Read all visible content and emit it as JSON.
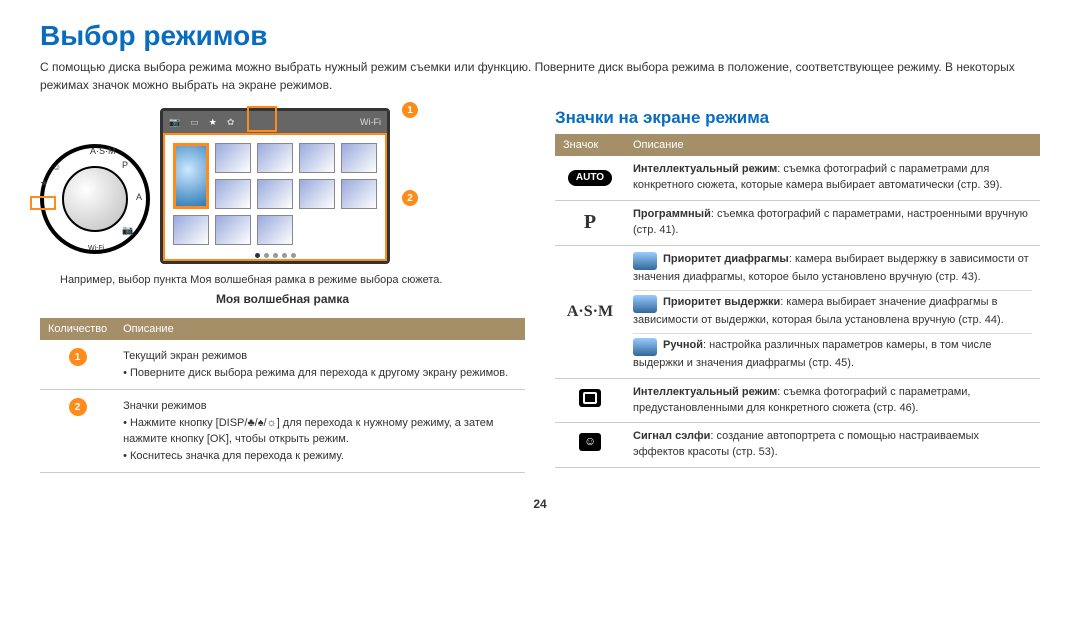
{
  "page": {
    "title": "Выбор режимов",
    "intro": "С помощью диска выбора режима можно выбрать нужный режим съемки или функцию. Поверните диск выбора режима в положение, соответствующее режиму. В некоторых режимах значок можно выбрать на экране режимов.",
    "number": "24"
  },
  "figure": {
    "caption_example": "Например, выбор пункта Моя волшебная рамка в режиме выбора сюжета.",
    "mode_name": "Моя волшебная рамка",
    "top_wifi": "Wi-Fi",
    "callout1": "1",
    "callout2": "2",
    "dial_wifi": "Wi-Fi"
  },
  "table1": {
    "head_qty": "Количество",
    "head_desc": "Описание",
    "rows": [
      {
        "idx": "1",
        "text": "Текущий экран режимов\n• Поверните диск выбора режима для перехода к другому экрану режимов."
      },
      {
        "idx": "2",
        "text": "Значки режимов\n• Нажмите кнопку [DISP/♣/♠/☼] для перехода к нужному режиму, а затем нажмите кнопку [OK], чтобы открыть режим.\n• Коснитесь значка для перехода к режиму."
      }
    ]
  },
  "right": {
    "subtitle": "Значки на экране режима",
    "head_icon": "Значок",
    "head_desc": "Описание"
  },
  "icons_table": [
    {
      "icon_kind": "auto",
      "icon_text": "AUTO",
      "desc_bold": "Интеллектуальный режим",
      "desc_rest": ": съемка фотографий с параметрами для конкретного сюжета, которые камера выбирает автоматически (стр. 39)."
    },
    {
      "icon_kind": "p",
      "icon_text": "P",
      "desc_bold": "Программный",
      "desc_rest": ": съемка фотографий с параметрами, настроенными вручную (стр. 41)."
    },
    {
      "icon_kind": "asm",
      "icon_text": "A·S·M",
      "sub": [
        {
          "bold": "Приоритет диафрагмы",
          "rest": ": камера выбирает выдержку в зависимости от значения диафрагмы, которое было установлено вручную (стр. 43)."
        },
        {
          "bold": "Приоритет выдержки",
          "rest": ": камера выбирает значение диафрагмы в зависимости от выдержки, которая была установлена вручную (стр. 44)."
        },
        {
          "bold": "Ручной",
          "rest": ": настройка различных параметров камеры, в том числе выдержки и значения диафрагмы (стр. 45)."
        }
      ]
    },
    {
      "icon_kind": "cam",
      "icon_text": "",
      "desc_bold": "Интеллектуальный режим",
      "desc_rest": ": съемка фотографий с параметрами, предустановленными для конкретного сюжета (стр. 46)."
    },
    {
      "icon_kind": "smile",
      "icon_text": "",
      "desc_bold": "Сигнал сэлфи",
      "desc_rest": ": создание автопортрета с помощью настраиваемых эффектов красоты (стр. 53)."
    }
  ]
}
